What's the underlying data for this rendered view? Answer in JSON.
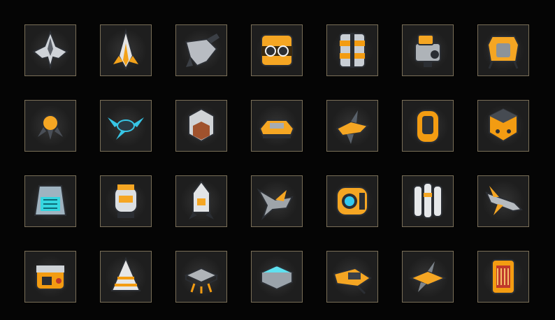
{
  "inventory": {
    "rows": [
      [
        {
          "icon": "gray-starfighter-icon",
          "kind": "fighter",
          "palette": [
            "#cfd3d8",
            "#5b6068"
          ]
        },
        {
          "icon": "white-orange-interceptor-icon",
          "kind": "dart",
          "palette": [
            "#e4e4e4",
            "#f3a21a"
          ]
        },
        {
          "icon": "gray-gunship-icon",
          "kind": "gunship",
          "palette": [
            "#b8bcc2",
            "#3b3f45"
          ]
        },
        {
          "icon": "orange-cube-drone-icon",
          "kind": "cube-eyes",
          "palette": [
            "#f5a623",
            "#3a2a10"
          ]
        },
        {
          "icon": "orange-armored-crate-icon",
          "kind": "crate",
          "palette": [
            "#f39c12",
            "#c9ced4"
          ]
        },
        {
          "icon": "gray-turret-module-icon",
          "kind": "turret",
          "palette": [
            "#aeb3b8",
            "#f5a623"
          ]
        },
        {
          "icon": "orange-cargo-pod-icon",
          "kind": "pod",
          "palette": [
            "#f5a623",
            "#8c9399"
          ]
        }
      ],
      [
        {
          "icon": "orange-small-drone-icon",
          "kind": "small-drone",
          "palette": [
            "#f5a623",
            "#4a4f57"
          ]
        },
        {
          "icon": "cyan-jet-drone-icon",
          "kind": "cyan-drone",
          "palette": [
            "#37c6e6",
            "#2a3a44"
          ]
        },
        {
          "icon": "gray-hex-container-icon",
          "kind": "hex",
          "palette": [
            "#d0d3d6",
            "#a0522d"
          ]
        },
        {
          "icon": "orange-armored-vehicle-icon",
          "kind": "vehicle",
          "palette": [
            "#f5a623",
            "#a7acb1"
          ]
        },
        {
          "icon": "orange-fighter-icon",
          "kind": "orange-fighter",
          "palette": [
            "#f5a623",
            "#59616a"
          ]
        },
        {
          "icon": "orange-capsule-icon",
          "kind": "capsule",
          "palette": [
            "#f39c12",
            "#2f3338"
          ]
        },
        {
          "icon": "orange-box-module-icon",
          "kind": "box-module",
          "palette": [
            "#f39c12",
            "#464b52"
          ]
        }
      ],
      [
        {
          "icon": "cyan-reactor-icon",
          "kind": "reactor",
          "palette": [
            "#9fb3c0",
            "#35d6e0"
          ]
        },
        {
          "icon": "white-armored-robot-icon",
          "kind": "robot",
          "palette": [
            "#dcdfe2",
            "#f5a623"
          ]
        },
        {
          "icon": "white-rocket-icon",
          "kind": "rocket",
          "palette": [
            "#e2e4e6",
            "#f5a623"
          ]
        },
        {
          "icon": "gray-orange-fighter-icon",
          "kind": "wing-fighter",
          "palette": [
            "#9ea4aa",
            "#f5a623"
          ]
        },
        {
          "icon": "orange-cyan-pod-icon",
          "kind": "eye-pod",
          "palette": [
            "#f5a623",
            "#34c9ee"
          ]
        },
        {
          "icon": "white-triple-canister-icon",
          "kind": "canister",
          "palette": [
            "#e6e8ea",
            "#f5a623"
          ]
        },
        {
          "icon": "gray-orange-missile-icon",
          "kind": "missile",
          "palette": [
            "#b6bbc0",
            "#f5a623"
          ]
        }
      ],
      [
        {
          "icon": "orange-generator-icon",
          "kind": "generator",
          "palette": [
            "#f39c12",
            "#cfd3d7"
          ]
        },
        {
          "icon": "white-pyramid-bunker-icon",
          "kind": "pyramid",
          "palette": [
            "#e6e6e6",
            "#f39c12"
          ]
        },
        {
          "icon": "gray-platform-icon",
          "kind": "platform",
          "palette": [
            "#b0b4b8",
            "#f39c12"
          ]
        },
        {
          "icon": "cyan-hologram-pad-icon",
          "kind": "holo-pad",
          "palette": [
            "#5fe1f0",
            "#9aa3ab"
          ]
        },
        {
          "icon": "orange-transport-ship-icon",
          "kind": "transport",
          "palette": [
            "#f5a623",
            "#3c4047"
          ]
        },
        {
          "icon": "orange-gray-fighter-icon",
          "kind": "orange-jet",
          "palette": [
            "#f5a623",
            "#7d848b"
          ]
        },
        {
          "icon": "orange-fuel-cell-icon",
          "kind": "fuel-cell",
          "palette": [
            "#f39c12",
            "#c0392b"
          ]
        }
      ]
    ]
  }
}
